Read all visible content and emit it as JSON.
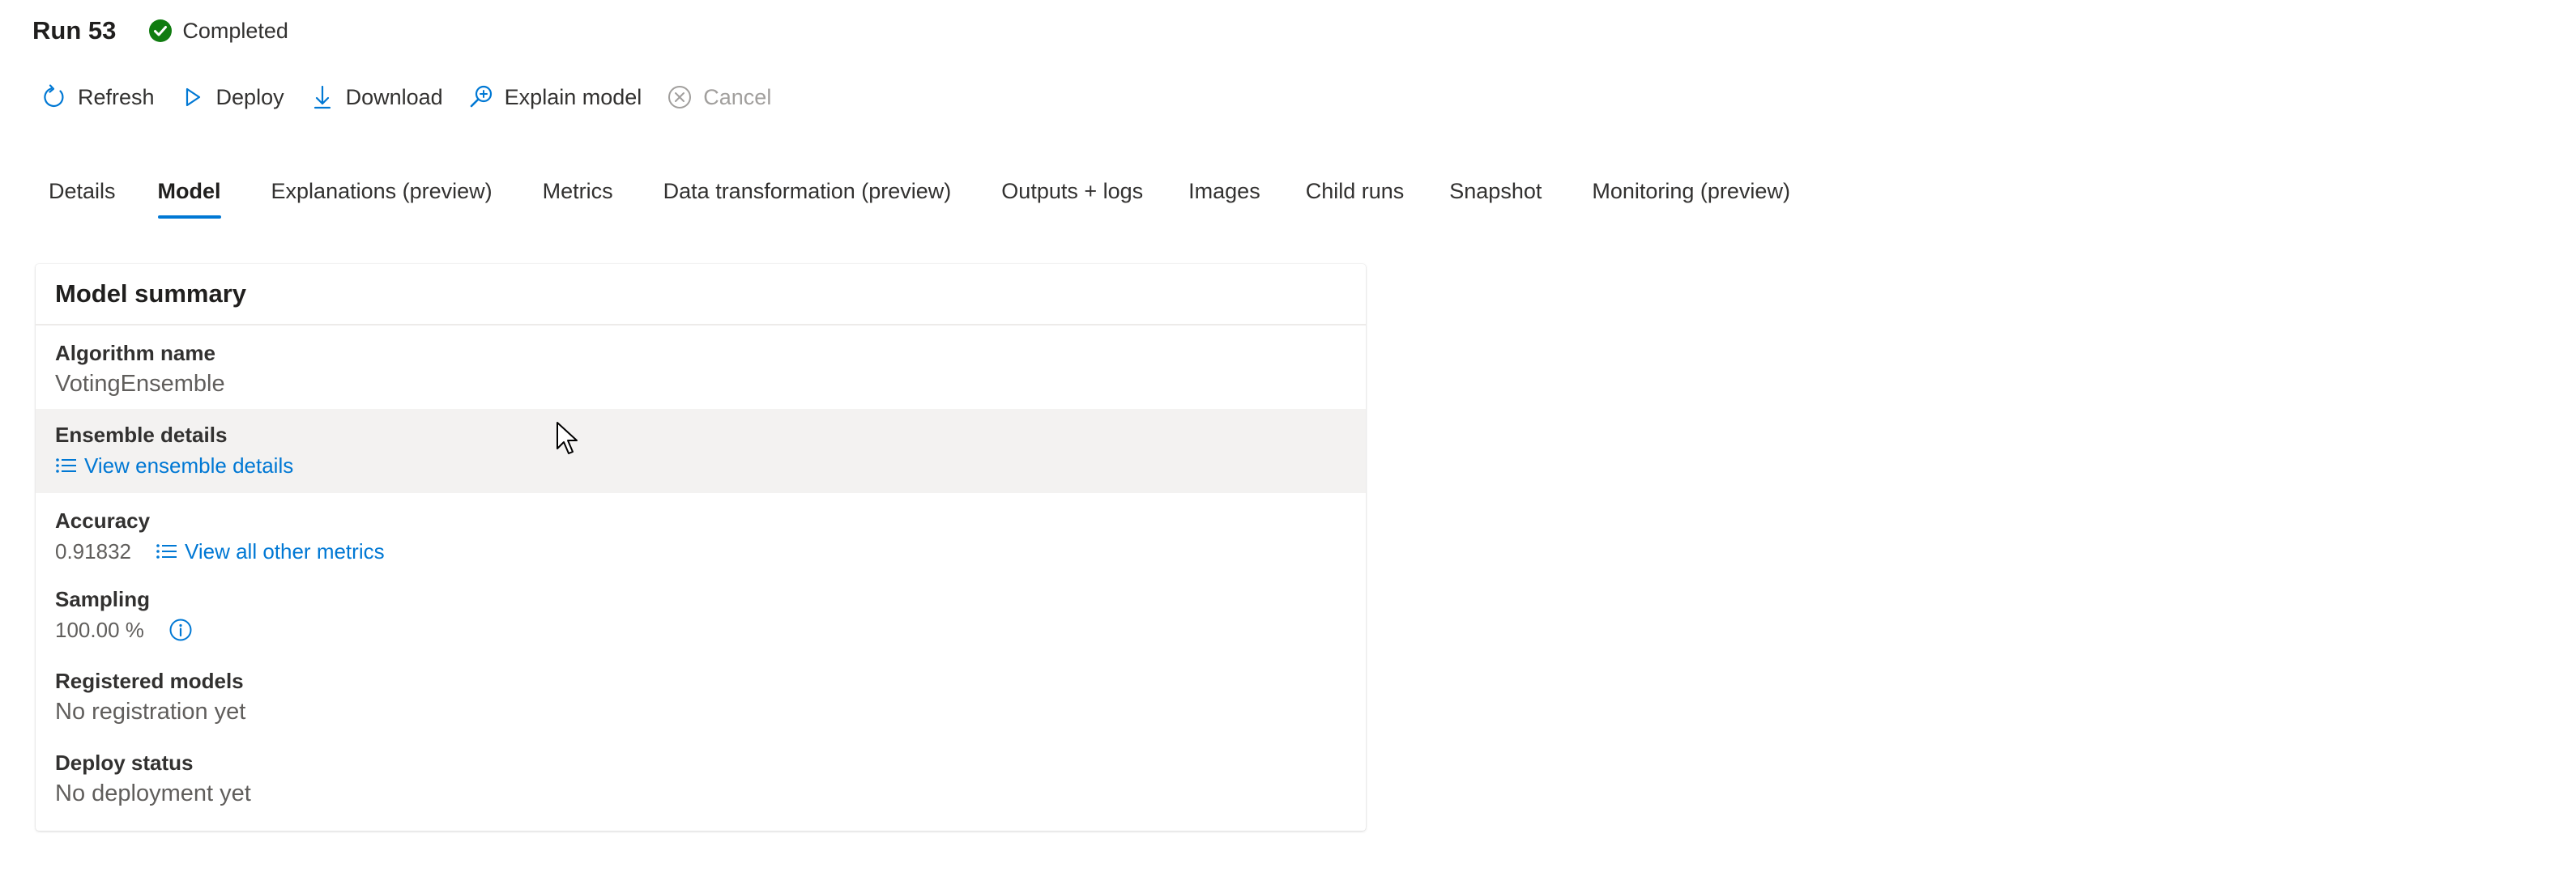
{
  "header": {
    "title": "Run 53",
    "status": "Completed",
    "status_color": "#107c10"
  },
  "toolbar": {
    "items": [
      {
        "label": "Refresh",
        "icon": "refresh-icon",
        "enabled": true
      },
      {
        "label": "Deploy",
        "icon": "deploy-icon",
        "enabled": true
      },
      {
        "label": "Download",
        "icon": "download-icon",
        "enabled": true
      },
      {
        "label": "Explain model",
        "icon": "explain-icon",
        "enabled": true
      },
      {
        "label": "Cancel",
        "icon": "cancel-icon",
        "enabled": false
      }
    ]
  },
  "tabs": [
    {
      "label": "Details",
      "active": false
    },
    {
      "label": "Model",
      "active": true
    },
    {
      "label": "Explanations (preview)",
      "active": false
    },
    {
      "label": "Metrics",
      "active": false
    },
    {
      "label": "Data transformation (preview)",
      "active": false
    },
    {
      "label": "Outputs + logs",
      "active": false
    },
    {
      "label": "Images",
      "active": false
    },
    {
      "label": "Child runs",
      "active": false
    },
    {
      "label": "Snapshot",
      "active": false
    },
    {
      "label": "Monitoring (preview)",
      "active": false
    }
  ],
  "model_summary": {
    "title": "Model summary",
    "algorithm": {
      "label": "Algorithm name",
      "value": "VotingEnsemble"
    },
    "ensemble": {
      "label": "Ensemble details",
      "link": "View ensemble details"
    },
    "accuracy": {
      "label": "Accuracy",
      "value": "0.91832",
      "link": "View all other metrics"
    },
    "sampling": {
      "label": "Sampling",
      "value": "100.00 %"
    },
    "registered": {
      "label": "Registered models",
      "value": "No registration yet"
    },
    "deploy": {
      "label": "Deploy status",
      "value": "No deployment yet"
    }
  },
  "colors": {
    "accent": "#0078d4",
    "text": "#323130",
    "muted": "#605e5c",
    "disabled": "#a19f9d",
    "row_highlight": "#f3f2f1"
  }
}
